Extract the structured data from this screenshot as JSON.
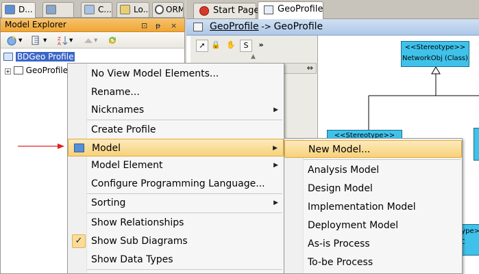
{
  "left_tabs": [
    {
      "label": "D..."
    },
    {
      "label": ""
    },
    {
      "label": "C..."
    },
    {
      "label": "Lo..."
    },
    {
      "label": "ORM"
    }
  ],
  "explorer": {
    "title": "Model Explorer",
    "controls": [
      "⊡",
      "ᵽ",
      "×"
    ],
    "tree": [
      {
        "label": "BDGeo Profile",
        "selected": true
      },
      {
        "label": "GeoProfile",
        "selected": false
      }
    ]
  },
  "right_tabs": [
    {
      "label": "Start Page"
    },
    {
      "label": "GeoProfile"
    }
  ],
  "breadcrumb": {
    "link": "GeoProfile",
    "sep": " -> ",
    "current": "GeoProfile"
  },
  "palette": {
    "s_label": "S",
    "more": "»"
  },
  "diagram": {
    "cls1": {
      "stereo": "<<Stereotype>>",
      "name": "NetworkObj (Class)"
    },
    "cls2": {
      "stereo": "<<Stereotype>>"
    },
    "cls3": {
      "stereo": "<<Stereotype>>",
      "name": "tionalArc (C"
    }
  },
  "context_menu": {
    "items": [
      {
        "label": "No View Model Elements..."
      },
      {
        "label": "Rename..."
      },
      {
        "label": "Nicknames",
        "submenu": true
      },
      {
        "label": "Create Profile"
      },
      {
        "label": "Model",
        "submenu": true,
        "highlighted": true
      },
      {
        "label": "Model Element",
        "submenu": true
      },
      {
        "label": "Configure Programming Language..."
      },
      {
        "label": "Sorting",
        "submenu": true
      },
      {
        "label": "Show Relationships"
      },
      {
        "label": "Show Sub Diagrams",
        "checked": true
      },
      {
        "label": "Show Data Types"
      }
    ]
  },
  "submenu": {
    "items": [
      {
        "label": "New Model...",
        "highlighted": true
      },
      {
        "label": "Analysis Model"
      },
      {
        "label": "Design Model"
      },
      {
        "label": "Implementation Model"
      },
      {
        "label": "Deployment Model"
      },
      {
        "label": "As-is Process"
      },
      {
        "label": "To-be Process"
      }
    ]
  },
  "colors": {
    "arrow": "#e02020",
    "selection": "#3b66c6",
    "highlight": "#f7d27a",
    "class_fill": "#3fc2ea"
  }
}
